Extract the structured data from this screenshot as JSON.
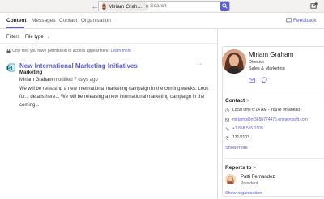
{
  "search": {
    "back_label": "←",
    "person_chip": "Miriam Grah...",
    "chip_close": "✕",
    "placeholder": "Search"
  },
  "tabs": [
    {
      "label": "Content",
      "active": true
    },
    {
      "label": "Messages",
      "active": false
    },
    {
      "label": "Contact",
      "active": false
    },
    {
      "label": "Organisation",
      "active": false
    }
  ],
  "feedback_label": "Feedback",
  "filters": {
    "label": "Filters",
    "file_type": "File type",
    "chevron": "⌄"
  },
  "permission_note": {
    "text": "Only files you have permission to access appear here.",
    "link": "Learn more"
  },
  "result": {
    "title": "New International Marketing Initiatives",
    "more": "···",
    "site": "Marketing",
    "author": "Miriam Graham",
    "modified": "modified 7 days ago",
    "snippet": "We will be releasing a new international marketing campaign in the coming weeks. Look for... details here... We will be releasing a new international marketing campaign in the coming..."
  },
  "profile": {
    "name": "Miriam Graham",
    "title": "Director",
    "department": "Sales & Marketing"
  },
  "contact": {
    "heading": "Contact",
    "chevron": ">",
    "local_time": "Local time 6:14 AM - You're 9h ahead",
    "email": "miriamg@m365b774475.onmicrosoft.com",
    "phone": "+1 858 555 0109",
    "office": "131/2103",
    "show_more": "Show more"
  },
  "reports": {
    "heading": "Reports to",
    "chevron": ">",
    "manager_name": "Patti Fernandez",
    "manager_title": "President",
    "show_org": "Show organisation"
  },
  "colors": {
    "accent": "#5b5fc7",
    "text": "#201f1e",
    "muted": "#605e5c",
    "border": "#e1dfdd"
  },
  "icons": {
    "back": "back-arrow-icon",
    "search": "search-icon",
    "popout": "popout-icon",
    "feedback": "feedback-icon",
    "lock": "lock-icon",
    "file": "sharepoint-file-icon",
    "mail": "mail-icon",
    "chat": "chat-icon",
    "clock": "clock-icon",
    "email": "email-icon",
    "phone": "phone-icon",
    "location": "location-icon"
  }
}
